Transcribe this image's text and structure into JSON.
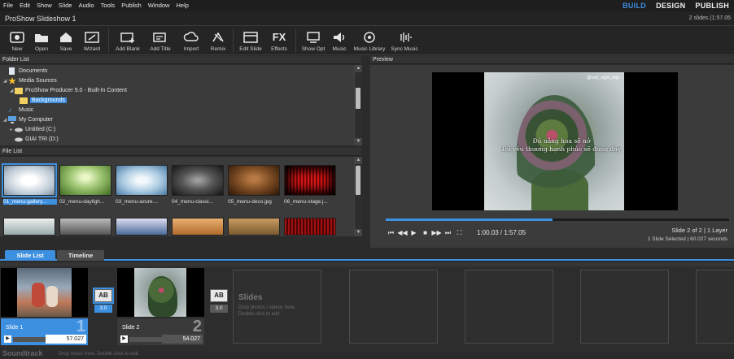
{
  "menu": [
    "File",
    "Edit",
    "Show",
    "Slide",
    "Audio",
    "Tools",
    "Publish",
    "Window",
    "Help"
  ],
  "modes": {
    "build": "BUILD",
    "design": "DESIGN",
    "publish": "PUBLISH"
  },
  "window": {
    "title": "ProShow Slideshow 1",
    "slide_count": "2 slides (1:57.05"
  },
  "toolbar": [
    {
      "label": "New",
      "icon": "new-show-icon"
    },
    {
      "label": "Open",
      "icon": "open-folder-icon"
    },
    {
      "label": "Save",
      "icon": "save-icon"
    },
    {
      "label": "Wizard",
      "icon": "wizard-icon"
    },
    {
      "label": "Add Blank",
      "icon": "add-blank-icon"
    },
    {
      "label": "Add Title",
      "icon": "add-title-icon"
    },
    {
      "label": "Import",
      "icon": "import-icon"
    },
    {
      "label": "Remix",
      "icon": "remix-icon"
    },
    {
      "label": "Edit Slide",
      "icon": "edit-slide-icon"
    },
    {
      "label": "Effects",
      "icon": "fx-icon"
    },
    {
      "label": "Show Opt",
      "icon": "show-options-icon"
    },
    {
      "label": "Music",
      "icon": "speaker-icon"
    },
    {
      "label": "Music Library",
      "icon": "music-library-icon"
    },
    {
      "label": "Sync Music",
      "icon": "sync-music-icon"
    }
  ],
  "folder_list": {
    "header": "Folder List",
    "items": [
      {
        "label": "Documents",
        "icon": "document-icon"
      },
      {
        "label": "Media Sources",
        "icon": "star-icon"
      },
      {
        "label": "ProShow Producer 9.0 - Built-In Content",
        "icon": "folder-icon"
      },
      {
        "label": "Backgrounds",
        "icon": "folder-icon"
      },
      {
        "label": "Music",
        "icon": "music-note-icon"
      },
      {
        "label": "My Computer",
        "icon": "computer-icon"
      },
      {
        "label": "Untitled (C:)",
        "icon": "drive-icon"
      },
      {
        "label": "GIAI TRI (D:)",
        "icon": "drive-icon"
      }
    ]
  },
  "file_list": {
    "header": "File List",
    "files": [
      {
        "name": "01_menu-gallery...",
        "color1": "#ffffff",
        "color2": "#8a9aa8"
      },
      {
        "name": "02_menu-dayligh...",
        "color1": "#d8f0b0",
        "color2": "#4a7a2a"
      },
      {
        "name": "03_menu-azure....",
        "color1": "#e6f2fa",
        "color2": "#5a8ab0"
      },
      {
        "name": "04_menu-classi...",
        "color1": "#9a9a9a",
        "color2": "#1a1a1a"
      },
      {
        "name": "05_menu-deco.jpg",
        "color1": "#a86a3a",
        "color2": "#3a2010"
      },
      {
        "name": "06_menu-stage.j...",
        "color1": "#e02020",
        "color2": "#200404"
      }
    ]
  },
  "preview": {
    "header": "Preview",
    "caption_line1": "Đủ nắng hoa sẽ nở",
    "caption_line2": "Đủ yêu thương hạnh phúc sẽ đong đầy",
    "handle": "@viet_nghi_mtp",
    "progress": 0.485,
    "time": "1:00.03 / 1:57.05",
    "slide_info": "Slide 2 of 2  |  1 Layer",
    "selection_info": "1 Slide Selected  |  60.027 seconds"
  },
  "tabs": {
    "slide_list": "Slide List",
    "timeline": "Timeline"
  },
  "slides": [
    {
      "name": "Slide 1",
      "number": "1",
      "duration": "57.027"
    },
    {
      "name": "Slide 2",
      "number": "2",
      "duration": "54.027"
    }
  ],
  "transitions": [
    {
      "label": "AB",
      "duration": "3.0"
    },
    {
      "label": "AB",
      "duration": "3.0"
    }
  ],
  "empty_slot": {
    "title": "Slides",
    "hint1": "Drop photos / videos here.",
    "hint2": "Double click to edit."
  },
  "soundtrack": {
    "title": "Soundtrack",
    "hint": "Drop music here.  Double click to edit."
  },
  "colors": {
    "accent": "#3d8fe0",
    "background": "#2b2b2b",
    "panel": "#3b3b3b"
  }
}
